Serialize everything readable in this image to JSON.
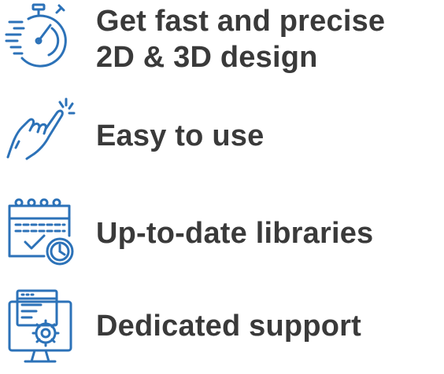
{
  "colors": {
    "icon_stroke": "#2c72b8",
    "text": "#3a3a3a",
    "background": "#ffffff"
  },
  "features": [
    {
      "icon": "stopwatch-icon",
      "lines": [
        "Get fast and precise",
        "2D & 3D design"
      ]
    },
    {
      "icon": "pointing-hand-icon",
      "lines": [
        "Easy to use"
      ]
    },
    {
      "icon": "calendar-check-clock-icon",
      "lines": [
        "Up-to-date libraries"
      ]
    },
    {
      "icon": "monitor-gear-icon",
      "lines": [
        "Dedicated support"
      ]
    }
  ]
}
